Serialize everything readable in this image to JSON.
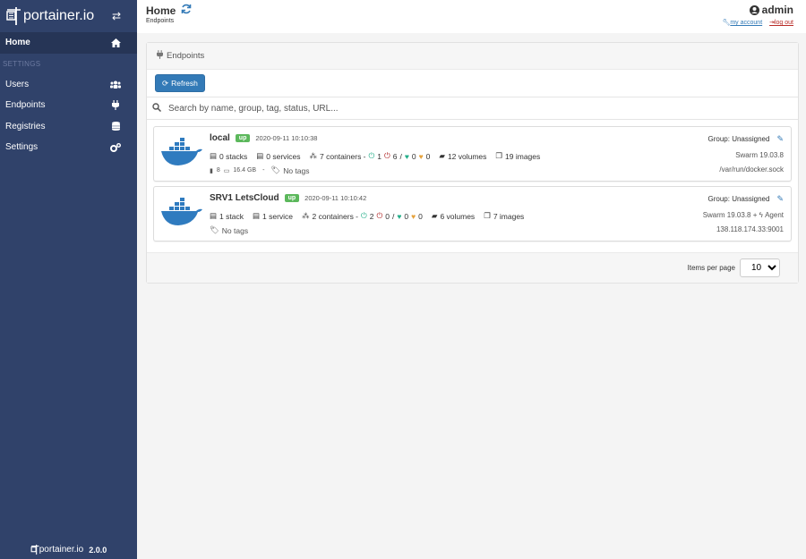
{
  "sidebar": {
    "brand": "portainer.io",
    "items": [
      {
        "label": "Home",
        "icon": "home-icon"
      },
      {
        "label": "Users",
        "icon": "users-icon"
      },
      {
        "label": "Endpoints",
        "icon": "plug-icon"
      },
      {
        "label": "Registries",
        "icon": "database-icon"
      },
      {
        "label": "Settings",
        "icon": "cogs-icon"
      }
    ],
    "section_title": "SETTINGS",
    "footer_brand": "portainer.io",
    "version": "2.0.0",
    "bg_color": "#30426a"
  },
  "header": {
    "title": "Home",
    "breadcrumb": "Endpoints",
    "user": "admin",
    "my_account": "my account",
    "logout": "log out"
  },
  "panel": {
    "title": "Endpoints",
    "refresh_label": "Refresh",
    "search_placeholder": "Search by name, group, tag, status, URL...",
    "items_per_page_label": "Items per page",
    "items_per_page": "10"
  },
  "endpoints": [
    {
      "name": "local",
      "status": "up",
      "timestamp": "2020-09-11 10:10:38",
      "stacks": "0 stacks",
      "services": "0 services",
      "containers": "7 containers -",
      "running": "1",
      "stopped": "6",
      "healthy": "0",
      "unhealthy": "0",
      "volumes": "12 volumes",
      "images": "19 images",
      "cpu": "8",
      "memory": "16.4 GB",
      "dash": "-",
      "tags": "No tags",
      "group": "Group: Unassigned",
      "engine": "Swarm 19.03.8",
      "url": "/var/run/docker.sock"
    },
    {
      "name": "SRV1 LetsCloud",
      "status": "up",
      "timestamp": "2020-09-11 10:10:42",
      "stacks": "1 stack",
      "services": "1 service",
      "containers": "2 containers -",
      "running": "2",
      "stopped": "0",
      "healthy": "0",
      "unhealthy": "0",
      "volumes": "6 volumes",
      "images": "7 images",
      "tags": "No tags",
      "group": "Group: Unassigned",
      "engine": "Swarm 19.03.8 +",
      "agent": "Agent",
      "url": "138.118.174.33:9001"
    }
  ]
}
